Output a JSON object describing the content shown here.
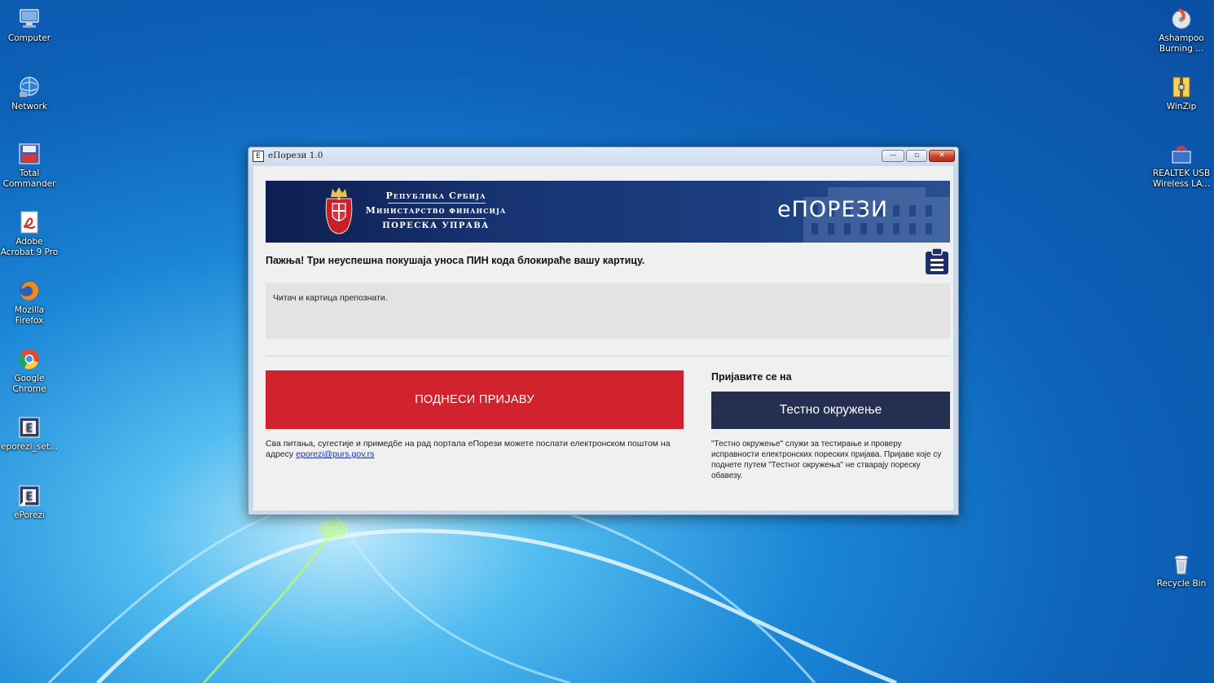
{
  "desktop": {
    "left_icons": [
      {
        "label1": "Computer",
        "label2": ""
      },
      {
        "label1": "Network",
        "label2": ""
      },
      {
        "label1": "Total",
        "label2": "Commander"
      },
      {
        "label1": "Adobe",
        "label2": "Acrobat 9 Pro"
      },
      {
        "label1": "Mozilla",
        "label2": "Firefox"
      },
      {
        "label1": "Google",
        "label2": "Chrome"
      },
      {
        "label1": "eporezi_set...",
        "label2": ""
      },
      {
        "label1": "ePorezi",
        "label2": ""
      }
    ],
    "right_icons": [
      {
        "label1": "Ashampoo",
        "label2": "Burning ..."
      },
      {
        "label1": "WinZip",
        "label2": ""
      },
      {
        "label1": "REALTEK USB",
        "label2": "Wireless LA..."
      },
      {
        "label1": "Recycle Bin",
        "label2": ""
      }
    ],
    "icon_names": [
      "computer-icon",
      "network-icon",
      "total-commander-icon",
      "acrobat-icon",
      "firefox-icon",
      "chrome-icon",
      "eporezi-setup-icon",
      "eporezi-icon",
      "ashampoo-icon",
      "winzip-icon",
      "realtek-icon",
      "recycle-bin-icon"
    ]
  },
  "window": {
    "title": "еПорези 1.0",
    "app_icon_glyph": "E",
    "controls": {
      "minimize": "—",
      "maximize": "▫",
      "close": "✕"
    }
  },
  "banner": {
    "line1": "Република Србија",
    "line2": "Министарство финансија",
    "line3": "ПОРЕСКА УПРАВА",
    "brand": "еПОРЕЗИ"
  },
  "warning": "Пажња! Три неуспешна покушаја уноса ПИН кода блокираће вашу картицу.",
  "status": "Читач и картица препознати.",
  "submit_button": "ПОДНЕСИ ПРИЈАВУ",
  "contact": {
    "text": "Сва питања, сугестије и примедбе на рад портала еПорези можете послати електронском поштом на адресу",
    "email": "eporezi@purs.gov.rs"
  },
  "login": {
    "label": "Пријавите се на",
    "test_button": "Тестно окружење",
    "note": "\"Тестно окружење\" служи за тестирање и проверу исправности електронских пореских пријава. Пријаве које су поднете путем \"Тестног окружења\" не стварају пореску обавезу."
  },
  "colors": {
    "submit": "#d1232e",
    "test": "#252f52",
    "banner": "#173471",
    "clipboard": "#1d2f6a"
  }
}
